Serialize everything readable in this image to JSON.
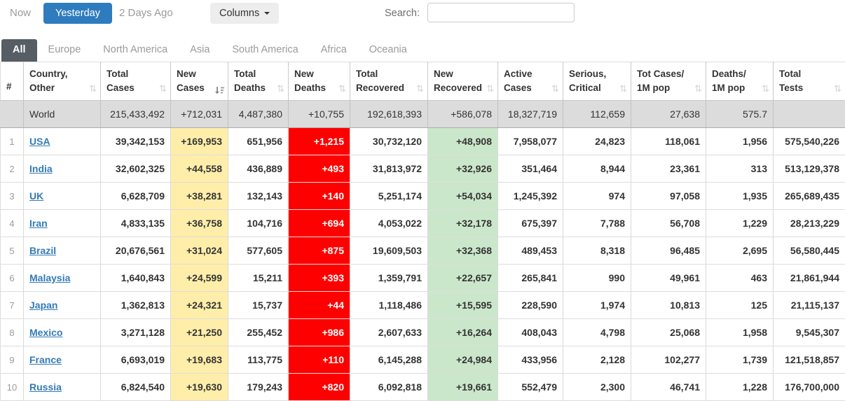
{
  "toolbar": {
    "now": "Now",
    "yesterday": "Yesterday",
    "two_days_ago": "2 Days Ago",
    "columns_label": "Columns",
    "search_label": "Search:",
    "search_value": ""
  },
  "tabs": [
    {
      "label": "All",
      "active": true
    },
    {
      "label": "Europe",
      "active": false
    },
    {
      "label": "North America",
      "active": false
    },
    {
      "label": "Asia",
      "active": false
    },
    {
      "label": "South America",
      "active": false
    },
    {
      "label": "Africa",
      "active": false
    },
    {
      "label": "Oceania",
      "active": false
    }
  ],
  "colors": {
    "primary_blue": "#2e7cbe",
    "link_blue": "#337ab7",
    "active_tab_bg": "#565d64",
    "new_cases_bg": "#FFEEAA",
    "new_deaths_bg": "#FF0000",
    "new_recovered_bg": "#CBE7CB"
  },
  "table": {
    "headers": [
      {
        "key": "rank",
        "line1": "#",
        "line2": "",
        "sort": "none"
      },
      {
        "key": "country",
        "line1": "Country,",
        "line2": "Other",
        "sort": "both"
      },
      {
        "key": "total_cases",
        "line1": "Total",
        "line2": "Cases",
        "sort": "both"
      },
      {
        "key": "new_cases",
        "line1": "New",
        "line2": "Cases",
        "sort": "desc"
      },
      {
        "key": "total_deaths",
        "line1": "Total",
        "line2": "Deaths",
        "sort": "both"
      },
      {
        "key": "new_deaths",
        "line1": "New",
        "line2": "Deaths",
        "sort": "both"
      },
      {
        "key": "total_recovered",
        "line1": "Total",
        "line2": "Recovered",
        "sort": "both"
      },
      {
        "key": "new_recovered",
        "line1": "New",
        "line2": "Recovered",
        "sort": "both"
      },
      {
        "key": "active_cases",
        "line1": "Active",
        "line2": "Cases",
        "sort": "both"
      },
      {
        "key": "serious_critical",
        "line1": "Serious,",
        "line2": "Critical",
        "sort": "both"
      },
      {
        "key": "tot_cases_1m",
        "line1": "Tot Cases/",
        "line2": "1M pop",
        "sort": "both"
      },
      {
        "key": "deaths_1m",
        "line1": "Deaths/",
        "line2": "1M pop",
        "sort": "both"
      },
      {
        "key": "total_tests",
        "line1": "Total",
        "line2": "Tests",
        "sort": "both"
      }
    ],
    "world_row": {
      "country": "World",
      "values": [
        "215,433,492",
        "+712,031",
        "4,487,380",
        "+10,755",
        "192,618,393",
        "+586,078",
        "18,327,719",
        "112,659",
        "27,638",
        "575.7",
        ""
      ]
    },
    "rows": [
      {
        "rank": "1",
        "country": "USA",
        "values": [
          "39,342,153",
          "+169,953",
          "651,956",
          "+1,215",
          "30,732,120",
          "+48,908",
          "7,958,077",
          "24,823",
          "118,061",
          "1,956",
          "575,540,226"
        ]
      },
      {
        "rank": "2",
        "country": "India",
        "values": [
          "32,602,325",
          "+44,558",
          "436,889",
          "+493",
          "31,813,972",
          "+32,926",
          "351,464",
          "8,944",
          "23,361",
          "313",
          "513,129,378"
        ]
      },
      {
        "rank": "3",
        "country": "UK",
        "values": [
          "6,628,709",
          "+38,281",
          "132,143",
          "+140",
          "5,251,174",
          "+54,034",
          "1,245,392",
          "974",
          "97,058",
          "1,935",
          "265,689,435"
        ]
      },
      {
        "rank": "4",
        "country": "Iran",
        "values": [
          "4,833,135",
          "+36,758",
          "104,716",
          "+694",
          "4,053,022",
          "+32,178",
          "675,397",
          "7,788",
          "56,708",
          "1,229",
          "28,213,229"
        ]
      },
      {
        "rank": "5",
        "country": "Brazil",
        "values": [
          "20,676,561",
          "+31,024",
          "577,605",
          "+875",
          "19,609,503",
          "+32,368",
          "489,453",
          "8,318",
          "96,485",
          "2,695",
          "56,580,445"
        ]
      },
      {
        "rank": "6",
        "country": "Malaysia",
        "values": [
          "1,640,843",
          "+24,599",
          "15,211",
          "+393",
          "1,359,791",
          "+22,657",
          "265,841",
          "990",
          "49,961",
          "463",
          "21,861,944"
        ]
      },
      {
        "rank": "7",
        "country": "Japan",
        "values": [
          "1,362,813",
          "+24,321",
          "15,737",
          "+44",
          "1,118,486",
          "+15,595",
          "228,590",
          "1,974",
          "10,813",
          "125",
          "21,115,137"
        ]
      },
      {
        "rank": "8",
        "country": "Mexico",
        "values": [
          "3,271,128",
          "+21,250",
          "255,452",
          "+986",
          "2,607,633",
          "+16,264",
          "408,043",
          "4,798",
          "25,068",
          "1,958",
          "9,545,307"
        ]
      },
      {
        "rank": "9",
        "country": "France",
        "values": [
          "6,693,019",
          "+19,683",
          "113,775",
          "+110",
          "6,145,288",
          "+24,984",
          "433,956",
          "2,128",
          "102,277",
          "1,739",
          "121,518,857"
        ]
      },
      {
        "rank": "10",
        "country": "Russia",
        "values": [
          "6,824,540",
          "+19,630",
          "179,243",
          "+820",
          "6,092,818",
          "+19,661",
          "552,479",
          "2,300",
          "46,741",
          "1,228",
          "176,700,000"
        ]
      }
    ]
  }
}
